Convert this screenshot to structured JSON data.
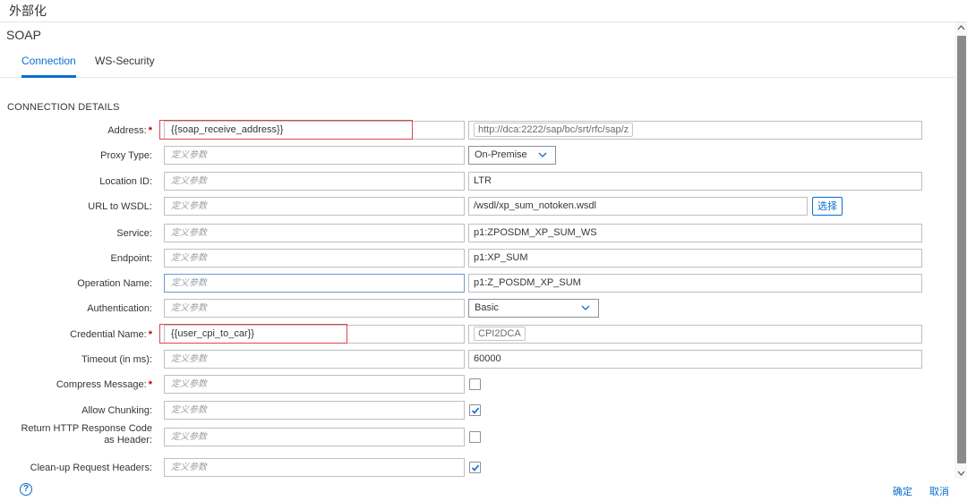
{
  "dialog": {
    "title": "外部化"
  },
  "section": {
    "name": "SOAP"
  },
  "tabs": [
    {
      "label": "Connection",
      "active": true
    },
    {
      "label": "WS-Security",
      "active": false
    }
  ],
  "group_title": "CONNECTION DETAILS",
  "placeholder": "定义参数",
  "fields": {
    "address": {
      "label": "Address:",
      "value": "{{soap_receive_address}}",
      "current": "http://dca:2222/sap/bc/srt/rfc/sap/z"
    },
    "proxy_type": {
      "label": "Proxy Type:",
      "current": "On-Premise"
    },
    "location_id": {
      "label": "Location ID:",
      "current": "LTR"
    },
    "url_to_wsdl": {
      "label": "URL to WSDL:",
      "current": "/wsdl/xp_sum_notoken.wsdl",
      "button": "选择"
    },
    "service": {
      "label": "Service:",
      "current": "p1:ZPOSDM_XP_SUM_WS"
    },
    "endpoint": {
      "label": "Endpoint:",
      "current": "p1:XP_SUM"
    },
    "operation_name": {
      "label": "Operation Name:",
      "current": "p1:Z_POSDM_XP_SUM"
    },
    "authentication": {
      "label": "Authentication:",
      "current": "Basic"
    },
    "credential_name": {
      "label": "Credential Name:",
      "value": "{{user_cpi_to_car}}",
      "current": "CPI2DCA"
    },
    "timeout": {
      "label": "Timeout (in ms):",
      "current": "60000"
    },
    "compress_message": {
      "label": "Compress Message:",
      "checked": false
    },
    "allow_chunking": {
      "label": "Allow Chunking:",
      "checked": true
    },
    "return_http": {
      "label_line1": "Return HTTP Response Code",
      "label_line2": "as Header:",
      "checked": false
    },
    "cleanup_headers": {
      "label": "Clean-up Request Headers:",
      "checked": true
    }
  },
  "required_mark": "*",
  "footer": {
    "help": "?",
    "ok": "确定",
    "cancel": "取消"
  },
  "colors": {
    "accent": "#0a6ed1",
    "required": "#bb0000",
    "highlight": "#e0454b"
  }
}
